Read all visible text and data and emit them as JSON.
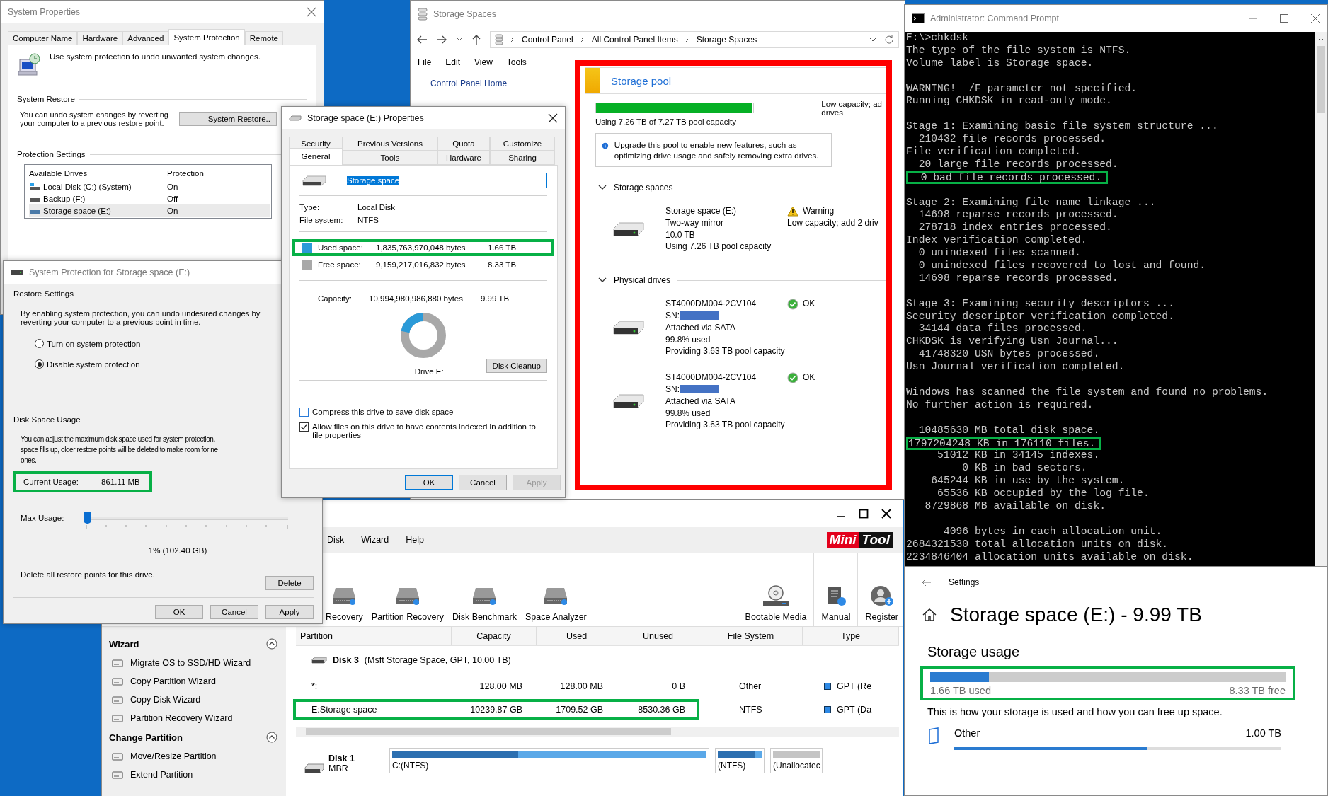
{
  "system_properties": {
    "title": "System Properties",
    "tabs": [
      {
        "label": "Computer Name",
        "selected": false
      },
      {
        "label": "Hardware",
        "selected": false
      },
      {
        "label": "Advanced",
        "selected": false
      },
      {
        "label": "System Protection",
        "selected": true
      },
      {
        "label": "Remote",
        "selected": false
      }
    ],
    "intro": "Use system protection to undo unwanted system changes.",
    "restore_group": {
      "title": "System Restore",
      "text": "You can undo system changes by reverting your computer to a previous restore point.",
      "button": "System Restore.."
    },
    "protection_group": {
      "title": "Protection Settings",
      "columns": [
        "Available Drives",
        "Protection"
      ],
      "drives": [
        {
          "name": "Local Disk (C:) (System)",
          "protection": "On",
          "kind": "system",
          "selected": false
        },
        {
          "name": "Backup (F:)",
          "protection": "Off",
          "kind": "plain",
          "selected": false
        },
        {
          "name": "Storage space (E:)",
          "protection": "On",
          "kind": "storage",
          "selected": true
        }
      ]
    }
  },
  "storage_spaces": {
    "title": "Storage Spaces",
    "breadcrumb": [
      "Control Panel",
      "All Control Panel Items",
      "Storage Spaces"
    ],
    "menu": [
      "File",
      "Edit",
      "View",
      "Tools"
    ],
    "side_link": "Control Panel Home",
    "pool": {
      "highlighted": true,
      "title": "Storage pool",
      "level": 0.99,
      "usage": "Using 7.26 TB of 7.27 TB pool capacity",
      "status_lines": [
        "Low capacity; ad",
        "drives"
      ],
      "info": "Upgrade this pool to enable new features, such as optimizing drive usage and safely removing extra drives.",
      "spaces_section": {
        "title": "Storage spaces",
        "expanded": true,
        "items": [
          {
            "lines": [
              "Storage space (E:)",
              "Two-way mirror",
              "10.0 TB",
              "Using 7.26 TB pool capacity"
            ],
            "status": "Warning",
            "kind": "warning",
            "status_detail": "Low capacity; add 2 driv"
          }
        ]
      },
      "drives_section": {
        "title": "Physical drives",
        "expanded": true,
        "items": [
          {
            "model": "ST4000DM004-2CV104",
            "serial_label": "SN:",
            "details": [
              "Attached via SATA",
              "99.8% used",
              "Providing 3.63 TB pool capacity"
            ],
            "status": "OK",
            "kind": "ok"
          },
          {
            "model": "ST4000DM004-2CV104",
            "serial_label": "SN:",
            "details": [
              "Attached via SATA",
              "99.8% used",
              "Providing 3.63 TB pool capacity"
            ],
            "status": "OK",
            "kind": "ok"
          }
        ]
      }
    }
  },
  "system_protection": {
    "title": "System Protection for Storage space (E:)",
    "restore_settings": {
      "title": "Restore Settings",
      "text": "By enabling system protection, you can undo undesired changes by reverting your computer to a previous point in time.",
      "options": [
        {
          "label": "Turn on system protection",
          "selected": false
        },
        {
          "label": "Disable system protection",
          "selected": true
        }
      ]
    },
    "disk_usage": {
      "title": "Disk Space Usage",
      "text_lines": [
        "You can adjust the maximum disk space used for system protection.",
        "space fills up, older restore points will be deleted to make room for ne",
        "ones."
      ],
      "current": {
        "label": "Current Usage:",
        "value": "861.11 MB",
        "highlighted": true
      },
      "max": {
        "label": "Max Usage:",
        "level": 0.01,
        "reading": "1% (102.40 GB)"
      },
      "delete_text": "Delete all restore points for this drive.",
      "delete_button": "Delete"
    },
    "buttons": [
      "OK",
      "Cancel",
      "Apply"
    ]
  },
  "minitool": {
    "menu": [
      "Disk",
      "Wizard",
      "Help"
    ],
    "logo": [
      "Mini",
      "Tool"
    ],
    "toolbar": [
      {
        "label": "Recovery",
        "kind": "drive"
      },
      {
        "label": "Partition Recovery",
        "kind": "drive"
      },
      {
        "label": "Disk Benchmark",
        "kind": "drive"
      },
      {
        "label": "Space Analyzer",
        "kind": "drive"
      },
      {
        "label": "Bootable Media",
        "kind": "disc"
      },
      {
        "label": "Manual",
        "kind": "document"
      },
      {
        "label": "Register",
        "kind": "user"
      }
    ],
    "sidebar": [
      {
        "title": "Wizard",
        "expanded": true,
        "items": [
          "Migrate OS to SSD/HD Wizard",
          "Copy Partition Wizard",
          "Copy Disk Wizard",
          "Partition Recovery Wizard"
        ]
      },
      {
        "title": "Change Partition",
        "expanded": true,
        "items": [
          "Move/Resize Partition",
          "Extend Partition"
        ]
      }
    ],
    "table": {
      "columns": [
        "Partition",
        "Capacity",
        "Used",
        "Unused",
        "File System",
        "Type"
      ],
      "disk": "Disk 3",
      "disk_detail": "(Msft Storage Space, GPT, 10.00 TB)",
      "rows": [
        {
          "cells": [
            "*:",
            "128.00 MB",
            "128.00 MB",
            "0 B",
            "Other",
            "GPT (Re"
          ],
          "highlighted": false
        },
        {
          "cells": [
            "E:Storage space",
            "10239.87 GB",
            "1709.52 GB",
            "8530.36 GB",
            "NTFS",
            "GPT (Da"
          ],
          "highlighted": true
        }
      ]
    },
    "disk_map": {
      "name": "Disk 1",
      "scheme": "MBR",
      "partitions": [
        {
          "label": "C:(NTFS)",
          "kind": "used",
          "level": 0.4
        },
        {
          "label": "(NTFS)",
          "kind": "used",
          "level": 0.85
        },
        {
          "label": "(Unallocatec",
          "kind": "unallocated"
        }
      ]
    }
  },
  "drive_properties": {
    "title": "Storage space (E:) Properties",
    "tab_rows": [
      [
        {
          "label": "Security",
          "selected": false
        },
        {
          "label": "Previous Versions",
          "selected": false
        },
        {
          "label": "Quota",
          "selected": false
        },
        {
          "label": "Customize",
          "selected": false
        }
      ],
      [
        {
          "label": "General",
          "selected": true
        },
        {
          "label": "Tools",
          "selected": false
        },
        {
          "label": "Hardware",
          "selected": false
        },
        {
          "label": "Sharing",
          "selected": false
        }
      ]
    ],
    "name_value": "Storage space",
    "type": {
      "label": "Type:",
      "value": "Local Disk"
    },
    "file_system": {
      "label": "File system:",
      "value": "NTFS"
    },
    "space": [
      {
        "label": "Used space:",
        "bytes": "1,835,763,970,048 bytes",
        "size": "1.66 TB",
        "color": "#2b9ad8",
        "highlighted": true
      },
      {
        "label": "Free space:",
        "bytes": "9,159,217,016,832 bytes",
        "size": "8.33 TB",
        "color": "#a8a8a8",
        "highlighted": false
      }
    ],
    "capacity": {
      "label": "Capacity:",
      "bytes": "10,994,980,986,880 bytes",
      "size": "9.99 TB"
    },
    "drive_label": "Drive E:",
    "cleanup_button": "Disk Cleanup",
    "options": [
      {
        "label": "Compress this drive to save disk space",
        "checked": false
      },
      {
        "label": "Allow files on this drive to have contents indexed in addition to file properties",
        "checked": true
      }
    ],
    "buttons": [
      {
        "label": "OK",
        "default": true,
        "disabled": false
      },
      {
        "label": "Cancel",
        "default": false,
        "disabled": false
      },
      {
        "label": "Apply",
        "default": false,
        "disabled": true
      }
    ]
  },
  "command_prompt": {
    "title": "Administrator: Command Prompt",
    "blocks": [
      [
        {
          "text": "E:\\>chkdsk",
          "highlighted": false
        },
        {
          "text": "The type of the file system is NTFS.",
          "highlighted": false
        },
        {
          "text": "Volume label is Storage space.",
          "highlighted": false
        }
      ],
      [
        {
          "text": "WARNING!  /F parameter not specified.",
          "highlighted": false
        },
        {
          "text": "Running CHKDSK in read-only mode.",
          "highlighted": false
        }
      ],
      [
        {
          "text": "Stage 1: Examining basic file system structure ...",
          "highlighted": false
        },
        {
          "text": "  210432 file records processed.",
          "highlighted": false
        },
        {
          "text": "File verification completed.",
          "highlighted": false
        },
        {
          "text": "  20 large file records processed.",
          "highlighted": false
        },
        {
          "text": "  0 bad file records processed.",
          "highlighted": true
        }
      ],
      [
        {
          "text": "Stage 2: Examining file name linkage ...",
          "highlighted": false
        },
        {
          "text": "  14698 reparse records processed.",
          "highlighted": false
        },
        {
          "text": "  278718 index entries processed.",
          "highlighted": false
        },
        {
          "text": "Index verification completed.",
          "highlighted": false
        },
        {
          "text": "  0 unindexed files scanned.",
          "highlighted": false
        },
        {
          "text": "  0 unindexed files recovered to lost and found.",
          "highlighted": false
        },
        {
          "text": "  14698 reparse records processed.",
          "highlighted": false
        }
      ],
      [
        {
          "text": "Stage 3: Examining security descriptors ...",
          "highlighted": false
        },
        {
          "text": "Security descriptor verification completed.",
          "highlighted": false
        },
        {
          "text": "  34144 data files processed.",
          "highlighted": false
        },
        {
          "text": "CHKDSK is verifying Usn Journal...",
          "highlighted": false
        },
        {
          "text": "  41748320 USN bytes processed.",
          "highlighted": false
        },
        {
          "text": "Usn Journal verification completed.",
          "highlighted": false
        }
      ],
      [
        {
          "text": "Windows has scanned the file system and found no problems.",
          "highlighted": false
        },
        {
          "text": "No further action is required.",
          "highlighted": false
        }
      ],
      [
        {
          "text": "  10485630 MB total disk space.",
          "highlighted": false
        },
        {
          "text": "1797204248 KB in 176110 files.",
          "highlighted": true
        },
        {
          "text": "     51012 KB in 34145 indexes.",
          "highlighted": false
        },
        {
          "text": "         0 KB in bad sectors.",
          "highlighted": false
        },
        {
          "text": "    645244 KB in use by the system.",
          "highlighted": false
        },
        {
          "text": "     65536 KB occupied by the log file.",
          "highlighted": false
        },
        {
          "text": "   8729868 MB available on disk.",
          "highlighted": false
        }
      ],
      [
        {
          "text": "      4096 bytes in each allocation unit.",
          "highlighted": false
        },
        {
          "text": "2684321530 total allocation units on disk.",
          "highlighted": false
        },
        {
          "text": "2234846404 allocation units available on disk.",
          "highlighted": false
        }
      ]
    ]
  },
  "settings": {
    "back_label": "Settings",
    "title": "Storage space (E:) - 9.99 TB",
    "section": "Storage usage",
    "usage": {
      "level": 0.166,
      "used": "1.66 TB used",
      "free": "8.33 TB free",
      "highlighted": true
    },
    "description": "This is how your storage is used and how you can free up space.",
    "categories": [
      {
        "name": "Other",
        "size": "1.00 TB",
        "level": 0.59
      }
    ]
  }
}
